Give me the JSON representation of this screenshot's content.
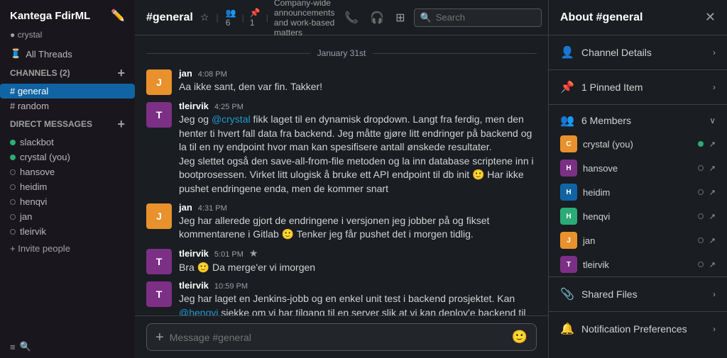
{
  "sidebar": {
    "workspace": "Kantega FdirML",
    "user": "crystal",
    "all_threads": "All Threads",
    "channels_section": "CHANNELS",
    "channels_count": "(2)",
    "channels": [
      {
        "name": "# general",
        "active": true
      },
      {
        "name": "# random",
        "active": false
      }
    ],
    "dm_section": "DIRECT MESSAGES",
    "dms": [
      {
        "name": "slackbot",
        "online": true
      },
      {
        "name": "crystal (you)",
        "online": true
      },
      {
        "name": "hansove",
        "online": false
      },
      {
        "name": "heidim",
        "online": false
      },
      {
        "name": "henqvi",
        "online": false
      },
      {
        "name": "jan",
        "online": false
      },
      {
        "name": "tleirvik",
        "online": false
      }
    ],
    "invite": "+ Invite people"
  },
  "header": {
    "channel": "#general",
    "star_icon": "☆",
    "pipe": "|",
    "members_count": "6",
    "pinned_count": "1",
    "description": "Company-wide announcements and work-based matters",
    "search_placeholder": "Search"
  },
  "date_label": "January 31st",
  "messages": [
    {
      "id": 1,
      "author": "jan",
      "time": "4:08 PM",
      "avatar_initial": "J",
      "avatar_class": "avatar-jan",
      "text": "Aa ikke sant, den var fin. Takker!"
    },
    {
      "id": 2,
      "author": "tleirvik",
      "time": "4:25 PM",
      "avatar_initial": "T",
      "avatar_class": "avatar-tleirvik",
      "text": "Jeg og @crystal fikk laget til en dynamisk dropdown. Langt fra ferdig, men den henter ti hvert fall data fra backend. Jeg måtte gjøre litt endringer på backend og la til en ny endpoint hvor man kan spesifisere antall ønskede resultater.\nJeg slettet også den save-all-from-file metoden og la inn database scriptene inn i bootprosessen. Virket litt ulogisk å bruke ett API endpoint til db init 🙂 Har ikke pushet endringene enda, men de kommer snart"
    },
    {
      "id": 3,
      "author": "jan",
      "time": "4:31 PM",
      "avatar_initial": "J",
      "avatar_class": "avatar-jan",
      "text": "Jeg har allerede gjort de endringene i versjonen jeg jobber på og fikset kommentarene i Gitlab 🙂 Tenker jeg får pushet det i morgen tidlig."
    },
    {
      "id": 4,
      "author": "tleirvik",
      "time": "5:01 PM",
      "starred": true,
      "avatar_initial": "T",
      "avatar_class": "avatar-tleirvik",
      "text": "Bra 🙂 Da merge'er vi imorgen",
      "has_actions": true
    },
    {
      "id": 5,
      "author": "tleirvik",
      "time": "10:59 PM",
      "avatar_initial": "T",
      "avatar_class": "avatar-tleirvik",
      "text": "Jeg har laget en Jenkins-jobb og en enkel unit test i backend prosjektet. Kan @henqvi sjekke om vi har tilgang til en server slik at vi kan deploy'e backend til en applikasjonsserver eller en *nix server"
    }
  ],
  "input": {
    "placeholder": "Message #general"
  },
  "about_panel": {
    "title": "About #general",
    "channel_details": "Channel Details",
    "pinned_item": "1 Pinned Item",
    "members": "6 Members",
    "members_list": [
      {
        "name": "crystal (you)",
        "online": true,
        "color": "#e8912d"
      },
      {
        "name": "hansove",
        "online": false,
        "color": "#7c3085"
      },
      {
        "name": "heidim",
        "online": false,
        "color": "#1164a3"
      },
      {
        "name": "henqvi",
        "online": false,
        "color": "#2bac76"
      },
      {
        "name": "jan",
        "online": false,
        "color": "#e8912d"
      },
      {
        "name": "tleirvik",
        "online": false,
        "color": "#7c3085"
      }
    ],
    "shared_files": "Shared Files",
    "notification_preferences": "Notification Preferences"
  },
  "icons": {
    "channel_details": "👤",
    "pinned": "📌",
    "members": "👥",
    "shared_files": "📎",
    "notifications": "🔔"
  }
}
